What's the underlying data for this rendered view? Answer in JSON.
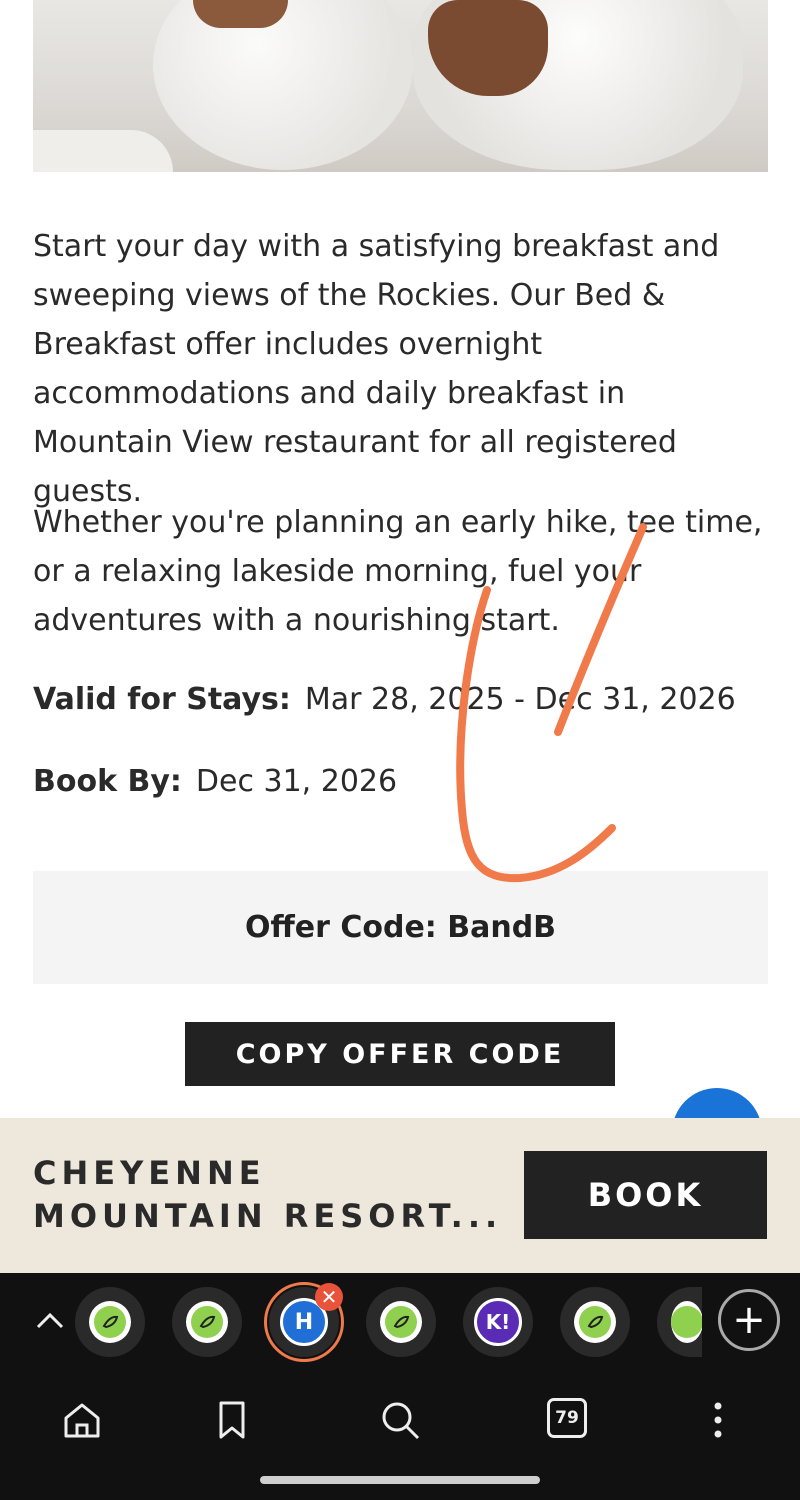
{
  "hero_image": {
    "alt_icon": "hero-photo"
  },
  "content": {
    "paragraph1": "Start your day with a satisfying breakfast and sweeping views of the Rockies. Our Bed & Breakfast offer includes overnight accommodations and daily breakfast in Mountain View restaurant for all registered guests.",
    "paragraph2": "Whether you're planning an early hike, tee time, or a relaxing lakeside morning, fuel your adventures with a nourishing start.",
    "valid_label": "Valid for Stays:",
    "valid_value": "Mar 28, 2025 -  Dec 31, 2026",
    "book_by_label": "Book By:",
    "book_by_value": "Dec 31, 2026",
    "offer_code_text": "Offer Code: BandB",
    "copy_button": "COPY OFFER CODE"
  },
  "booking_bar": {
    "resort_name": "CHEYENNE MOUNTAIN RESORT...",
    "book_button": "BOOK"
  },
  "browser": {
    "tab_count": "79",
    "tabs": [
      {
        "icon": "green-leaf-icon"
      },
      {
        "icon": "green-leaf-icon"
      },
      {
        "icon": "h-logo-icon",
        "letter": "H",
        "active": true
      },
      {
        "icon": "green-leaf-icon"
      },
      {
        "icon": "k-logo-icon",
        "letter": "K!"
      },
      {
        "icon": "green-leaf-icon"
      },
      {
        "icon": "green-leaf-icon"
      }
    ],
    "colors": {
      "accent": "#f07a4a",
      "bar": "#111111"
    }
  }
}
